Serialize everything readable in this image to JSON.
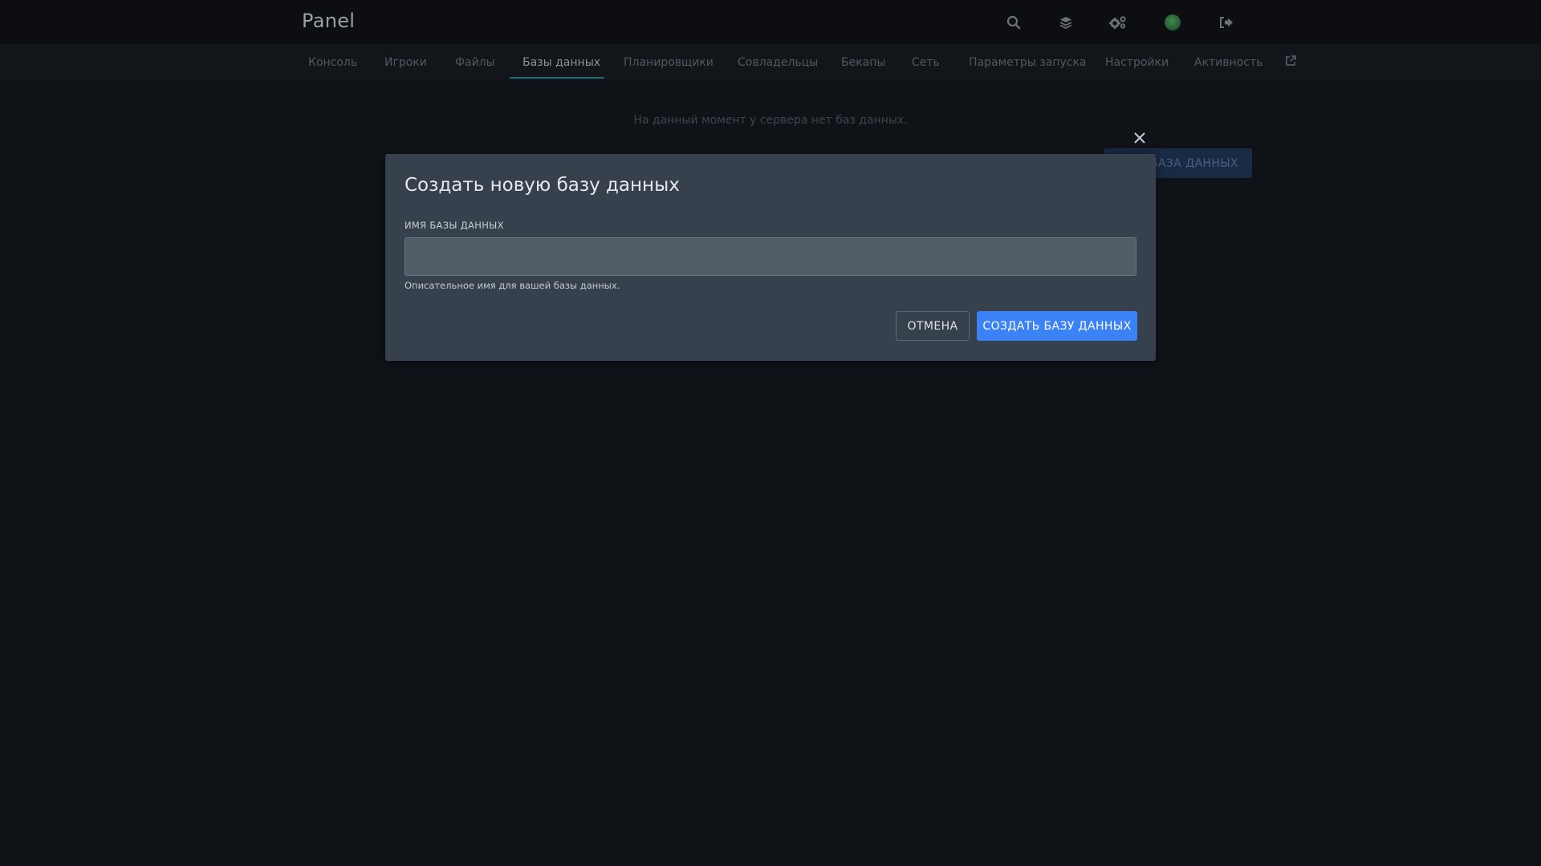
{
  "header": {
    "brand": "Panel",
    "icons": [
      "search-icon",
      "layers-icon",
      "cogs-icon",
      "avatar",
      "sign-out-icon"
    ]
  },
  "nav": {
    "tabs": [
      {
        "label": "Консоль",
        "active": false
      },
      {
        "label": "Игроки",
        "active": false
      },
      {
        "label": "Файлы",
        "active": false
      },
      {
        "label": "Базы данных",
        "active": true
      },
      {
        "label": "Планировщики",
        "active": false
      },
      {
        "label": "Совладельцы",
        "active": false
      },
      {
        "label": "Бекапы",
        "active": false
      },
      {
        "label": "Сеть",
        "active": false
      },
      {
        "label": "Параметры запуска",
        "active": false
      },
      {
        "label": "Настройки",
        "active": false
      },
      {
        "label": "Активность",
        "active": false
      }
    ],
    "external_link_icon": "external-link-icon"
  },
  "content": {
    "empty_message": "На данный момент у сервера нет баз данных.",
    "create_button_label": "БАЗА ДАННЫХ"
  },
  "modal": {
    "title": "Создать новую базу данных",
    "field_label": "ИМЯ БАЗЫ ДАННЫХ",
    "field_value": "",
    "field_help": "Описательное имя для вашей базы данных.",
    "cancel_label": "ОТМЕНА",
    "submit_label": "СОЗДАТЬ БАЗУ ДАННЫХ",
    "close_icon": "close-icon"
  },
  "colors": {
    "background": "#0f1318",
    "modal": "#37414d",
    "accent": "#3b82f6",
    "active_tab_underline": "#1e6b73"
  }
}
